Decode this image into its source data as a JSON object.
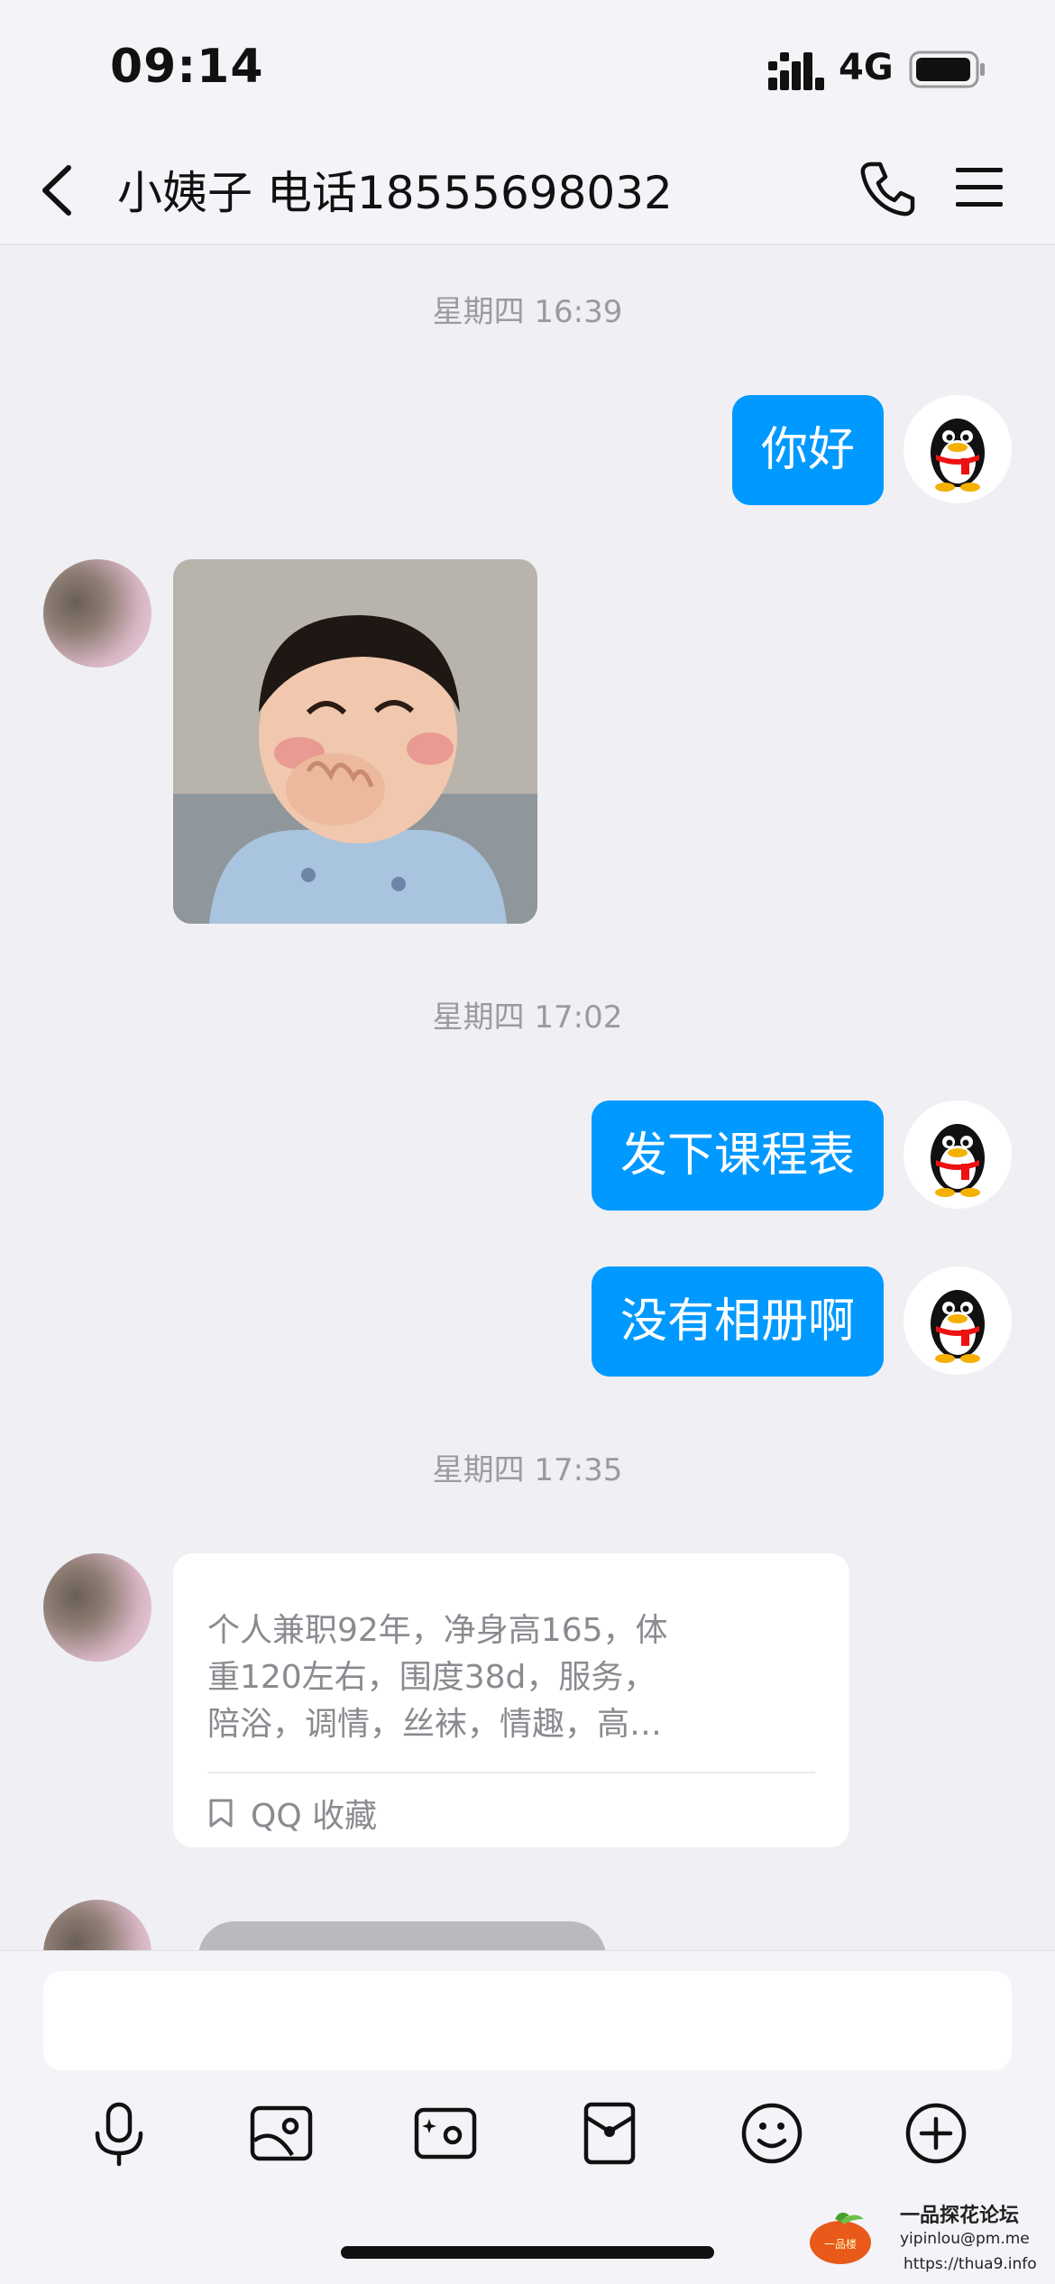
{
  "status_bar": {
    "time": "09:14",
    "network": "4G",
    "icons": [
      "signal-icon",
      "battery-icon"
    ]
  },
  "nav": {
    "title": "小姨子 电话18555698032",
    "icons": [
      "back-icon",
      "phone-icon",
      "menu-icon"
    ]
  },
  "messages": {
    "ts1": "星期四 16:39",
    "msg1": "你好",
    "ts2": "星期四 17:02",
    "msg2": "发下课程表",
    "msg3": "没有相册啊",
    "ts3": "星期四 17:35",
    "card": {
      "lines": [
        "个人兼职92年，净身高165，体",
        "重120左右，围度38d，服务，",
        "陪浴，调情，丝袜，情趣，高…"
      ],
      "source": "QQ 收藏"
    }
  },
  "toolbar": {
    "icons": [
      "microphone-icon",
      "photo-icon",
      "camera-icon",
      "red-packet-icon",
      "emoji-icon",
      "plus-icon"
    ]
  },
  "watermark": {
    "title": "一品探花论坛",
    "email": "yipinlou@pm.me",
    "url": "https://thua9.info",
    "logo_text": "一品楼"
  },
  "colors": {
    "accent": "#0099ff",
    "background": "#efeff4"
  }
}
